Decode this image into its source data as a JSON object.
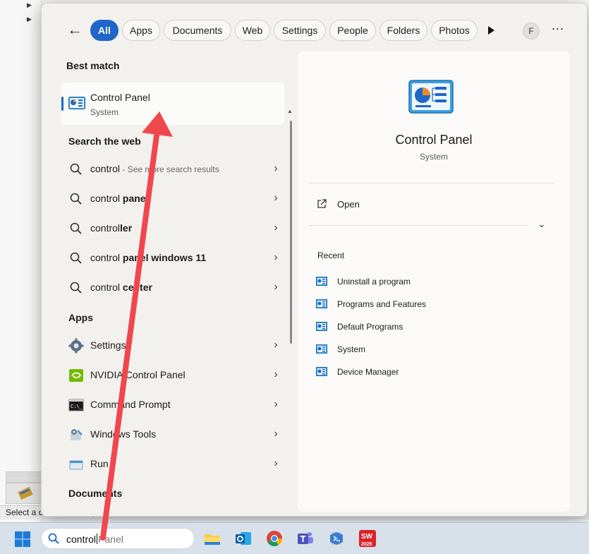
{
  "background": {
    "status_text": "Select a document temp"
  },
  "flyout": {
    "filters": [
      {
        "label": "All",
        "active": true
      },
      {
        "label": "Apps"
      },
      {
        "label": "Documents"
      },
      {
        "label": "Web"
      },
      {
        "label": "Settings"
      },
      {
        "label": "People"
      },
      {
        "label": "Folders"
      },
      {
        "label": "Photos"
      }
    ],
    "avatar_initial": "F",
    "best_match": {
      "heading": "Best match",
      "title": "Control Panel",
      "subtitle": "System"
    },
    "web": {
      "heading": "Search the web",
      "items": [
        {
          "typed": "control",
          "rest": "",
          "hint": " - See more search results"
        },
        {
          "typed": "control",
          "rest": " panel",
          "hint": ""
        },
        {
          "typed": "control",
          "rest": "ler",
          "hint": ""
        },
        {
          "typed": "control",
          "rest": " panel windows 11",
          "hint": ""
        },
        {
          "typed": "control",
          "rest": " center",
          "hint": ""
        }
      ]
    },
    "apps": {
      "heading": "Apps",
      "items": [
        {
          "label": "Settings",
          "icon": "gear-icon"
        },
        {
          "label": "NVIDIA Control Panel",
          "icon": "nvidia-icon"
        },
        {
          "label": "Command Prompt",
          "icon": "terminal-icon"
        },
        {
          "label": "Windows Tools",
          "icon": "tools-icon"
        },
        {
          "label": "Run",
          "icon": "run-icon"
        }
      ]
    },
    "documents": {
      "heading": "Documents"
    },
    "preview": {
      "title": "Control Panel",
      "subtitle": "System",
      "open_label": "Open",
      "recent_heading": "Recent",
      "recent": [
        "Uninstall a program",
        "Programs and Features",
        "Default Programs",
        "System",
        "Device Manager"
      ]
    }
  },
  "taskbar": {
    "search_typed": "control",
    "search_ghost": "Panel",
    "apps": [
      "file-explorer-icon",
      "outlook-icon",
      "chrome-icon",
      "teams-icon",
      "visual-studio-icon",
      "solidworks-icon"
    ],
    "solidworks_badge": "2025"
  },
  "colors": {
    "accent": "#1f66c8",
    "annotation_arrow": "#f0474d"
  }
}
